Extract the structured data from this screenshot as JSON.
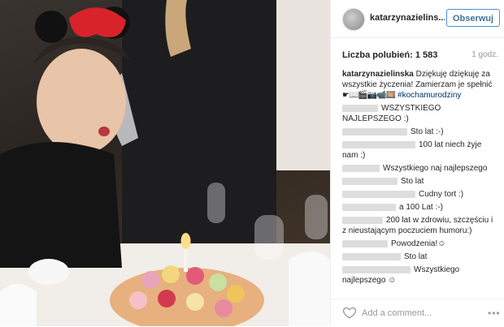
{
  "header": {
    "username": "katarzynazielins...",
    "follow_label": "Obserwuj"
  },
  "stats": {
    "likes_label": "Liczba polubień: 1 583",
    "time": "1 godz."
  },
  "caption": {
    "user": "katarzynazielinska",
    "text": "Dziękuję dziękuję za wszystkie życzenia! Zamierzam je spełnić",
    "emojis": "☛📖🎬📷📹🎞️",
    "hashtag": "#kochamurodziny"
  },
  "comments": [
    {
      "text": "WSZYSTKIEGO NAJLEPSZEGO :)"
    },
    {
      "text": "Sto lat :-)"
    },
    {
      "text": "100 lat niech żyje nam :)"
    },
    {
      "text": "Wszystkiego naj najlepszego"
    },
    {
      "text": "Sto lat"
    },
    {
      "text": "Cudny tort :)"
    },
    {
      "text": "a 100 Lat :-)"
    },
    {
      "text": "200 lat w zdrowiu, szczęściu i z nieustającym poczuciem humoru:)"
    },
    {
      "text": "Powodzenia!☺"
    },
    {
      "text": "Sto lat"
    },
    {
      "text": "Wszystkiego najlepszego ☺"
    }
  ],
  "footer": {
    "add_comment_placeholder": "Add a comment...",
    "more": "•••"
  },
  "icons": {
    "like": "heart-icon",
    "more": "more-dots-icon"
  }
}
